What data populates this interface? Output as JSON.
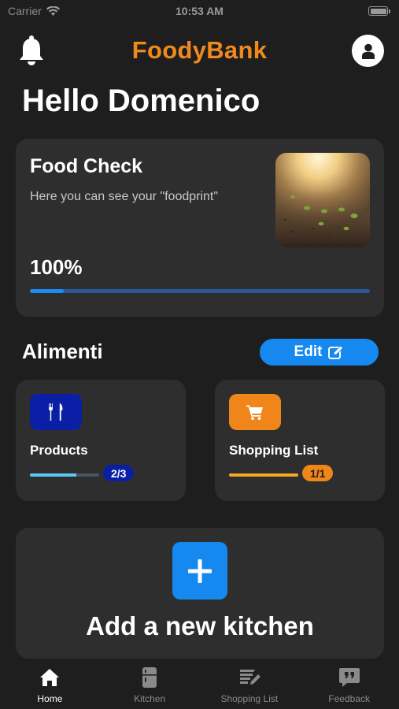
{
  "status_bar": {
    "carrier": "Carrier",
    "time": "10:53 AM"
  },
  "header": {
    "brand": "FoodyBank",
    "bell_icon": "bell-icon",
    "avatar_icon": "user-icon"
  },
  "greeting": "Hello Domenico",
  "food_check": {
    "title": "Food Check",
    "subtitle": "Here you can see your \"foodprint\"",
    "percentage": "100%",
    "progress_fraction": 0.1,
    "image_icon": "seedlings-photo"
  },
  "alimenti": {
    "title": "Alimenti",
    "edit_label": "Edit",
    "edit_icon": "edit-icon"
  },
  "products": {
    "title": "Products",
    "badge": "2/3",
    "progress_fraction": 0.667,
    "icon": "utensils-icon",
    "color": "#0a1fa6"
  },
  "shopping_list": {
    "title": "Shopping List",
    "badge": "1/1",
    "progress_fraction": 1.0,
    "icon": "cart-icon",
    "color": "#f0861a"
  },
  "add_kitchen": {
    "label": "Add a new kitchen",
    "icon": "plus-icon"
  },
  "tabs": [
    {
      "label": "Home",
      "icon": "home-icon",
      "active": true
    },
    {
      "label": "Kitchen",
      "icon": "fridge-icon",
      "active": false
    },
    {
      "label": "Shopping List",
      "icon": "shopping-list-icon",
      "active": false
    },
    {
      "label": "Feedback",
      "icon": "feedback-icon",
      "active": false
    }
  ],
  "colors": {
    "accent": "#1589f0",
    "brand": "#f08a1e",
    "background": "#1e1e1e",
    "card": "#2e2e2e"
  }
}
